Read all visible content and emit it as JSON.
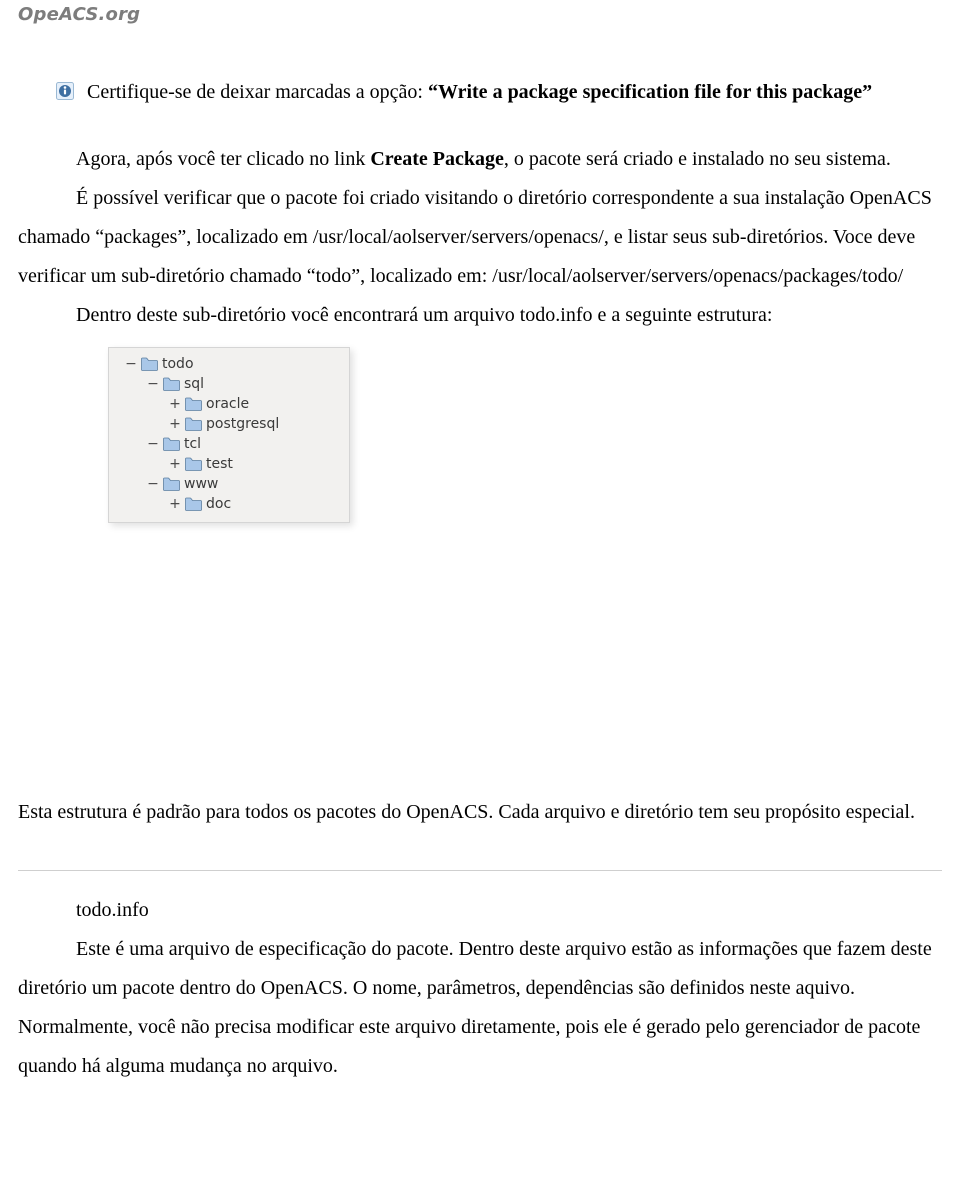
{
  "header": {
    "site": "OpeACS.org"
  },
  "p1": {
    "pre": "Certifique-se de deixar marcadas a opção: ",
    "bold": "“Write a package specification file for this package”"
  },
  "p2": {
    "pre": "Agora, após você  ter clicado no link ",
    "bold": "Create Package",
    "post": ", o pacote será criado e instalado no seu sistema."
  },
  "p3": "É possível verificar que o pacote foi criado visitando o diretório correspondente a sua instalação OpenACS chamado “packages”,   localizado em /usr/local/aolserver/servers/openacs/, e listar seus sub-diretórios. Voce deve verificar um sub-diretório chamado “todo”, localizado em: /usr/local/aolserver/servers/openacs/packages/todo/",
  "p4": "Dentro deste sub-diretório você encontrará um arquivo todo.info e a seguinte estrutura:",
  "tree": {
    "nodes": [
      {
        "label": "todo",
        "depth": 0,
        "expander": "−"
      },
      {
        "label": "sql",
        "depth": 1,
        "expander": "−"
      },
      {
        "label": "oracle",
        "depth": 2,
        "expander": "+"
      },
      {
        "label": "postgresql",
        "depth": 2,
        "expander": "+"
      },
      {
        "label": "tcl",
        "depth": 1,
        "expander": "−"
      },
      {
        "label": "test",
        "depth": 2,
        "expander": "+"
      },
      {
        "label": "www",
        "depth": 1,
        "expander": "−"
      },
      {
        "label": "doc",
        "depth": 2,
        "expander": "+"
      }
    ]
  },
  "p5": "Esta estrutura é padrão para todos os pacotes do OpenACS. Cada arquivo e diretório tem seu propósito especial.",
  "section": {
    "title": "todo.info",
    "body": "Este é uma arquivo de especificação do pacote. Dentro deste arquivo estão as informações que fazem deste diretório um pacote dentro do OpenACS. O nome, parâmetros, dependências são definidos neste aquivo. Normalmente, você não precisa modificar este arquivo diretamente, pois ele é gerado pelo gerenciador de pacote quando há alguma mudança no arquivo."
  },
  "glyphs": {
    "note_prefix": " "
  }
}
